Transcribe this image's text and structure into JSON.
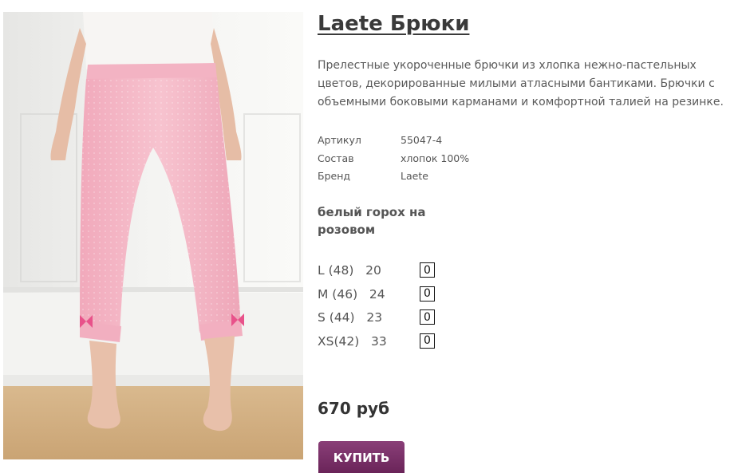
{
  "product": {
    "title": "Laete Брюки",
    "description": "Прелестные укороченные брючки из хлопка нежно-пастельных цветов, декорированные милыми атласными бантиками. Брючки с объемными боковыми карманами и комфортной талией на резинке.",
    "photo_alt": "product-photo"
  },
  "specs": [
    {
      "label": "Артикул",
      "value": "55047-4"
    },
    {
      "label": "Состав",
      "value": "хлопок 100%"
    },
    {
      "label": "Бренд",
      "value": "Laete"
    }
  ],
  "color_name": "белый горох на розовом",
  "sizes": [
    {
      "label": "L (48)   20",
      "qty": "0"
    },
    {
      "label": "M (46)   24",
      "qty": "0"
    },
    {
      "label": "S (44)   23",
      "qty": "0"
    },
    {
      "label": "XS(42)   33",
      "qty": "0"
    }
  ],
  "price": "670 руб",
  "buy_label": "КУПИТЬ",
  "colors": {
    "accent": "#7a3168",
    "pants": "#f4b8c6",
    "bow": "#e8528a"
  }
}
